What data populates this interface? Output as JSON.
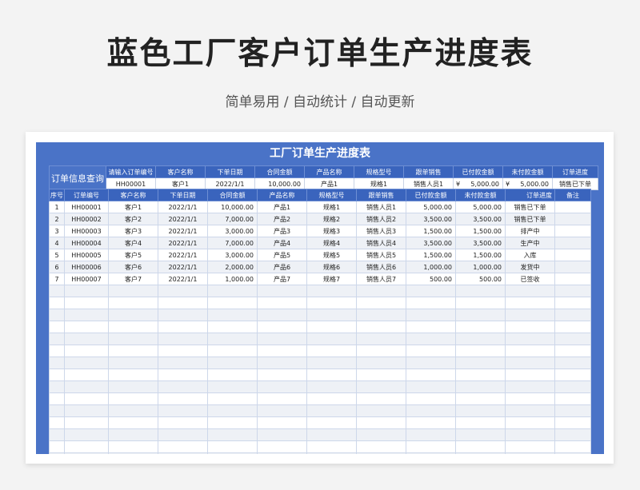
{
  "page": {
    "title": "蓝色工厂客户订单生产进度表",
    "subtitle": "简单易用 / 自动统计 / 自动更新"
  },
  "sheet": {
    "banner": "工厂订单生产进度表",
    "query": {
      "label": "订单信息查询",
      "headers": [
        "请输入订单编号",
        "客户名称",
        "下单日期",
        "合同金额",
        "产品名称",
        "规格型号",
        "跟单销售",
        "已付款金额",
        "未付款金额",
        "订单进度"
      ],
      "values": [
        "HH00001",
        "客户1",
        "2022/1/1",
        "10,000.00",
        "产品1",
        "规格1",
        "销售人员1",
        "5,000.00",
        "5,000.00",
        "销售已下单"
      ],
      "currency": "¥"
    },
    "columns": [
      "序号",
      "订单编号",
      "客户名称",
      "下单日期",
      "合同金额",
      "产品名称",
      "规格型号",
      "跟单销售",
      "已付款金额",
      "未付款金额",
      "订单进度",
      "备注"
    ],
    "rows": [
      [
        "1",
        "HH00001",
        "客户1",
        "2022/1/1",
        "10,000.00",
        "产品1",
        "规格1",
        "销售人员1",
        "5,000.00",
        "5,000.00",
        "销售已下单",
        ""
      ],
      [
        "2",
        "HH00002",
        "客户2",
        "2022/1/1",
        "7,000.00",
        "产品2",
        "规格2",
        "销售人员2",
        "3,500.00",
        "3,500.00",
        "销售已下单",
        ""
      ],
      [
        "3",
        "HH00003",
        "客户3",
        "2022/1/1",
        "3,000.00",
        "产品3",
        "规格3",
        "销售人员3",
        "1,500.00",
        "1,500.00",
        "排产中",
        ""
      ],
      [
        "4",
        "HH00004",
        "客户4",
        "2022/1/1",
        "7,000.00",
        "产品4",
        "规格4",
        "销售人员4",
        "3,500.00",
        "3,500.00",
        "生产中",
        ""
      ],
      [
        "5",
        "HH00005",
        "客户5",
        "2022/1/1",
        "3,000.00",
        "产品5",
        "规格5",
        "销售人员5",
        "1,500.00",
        "1,500.00",
        "入库",
        ""
      ],
      [
        "6",
        "HH00006",
        "客户6",
        "2022/1/1",
        "2,000.00",
        "产品6",
        "规格6",
        "销售人员6",
        "1,000.00",
        "1,000.00",
        "发货中",
        ""
      ],
      [
        "7",
        "HH00007",
        "客户7",
        "2022/1/1",
        "1,000.00",
        "产品7",
        "规格7",
        "销售人员7",
        "500.00",
        "500.00",
        "已签收",
        ""
      ]
    ],
    "empty_rows": 15
  }
}
